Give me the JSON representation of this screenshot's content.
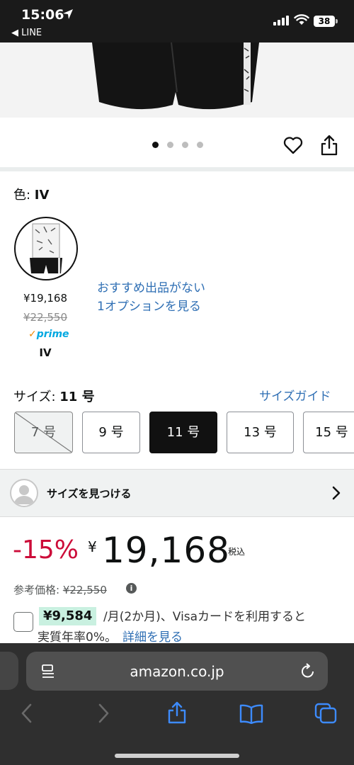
{
  "status": {
    "time": "15:06",
    "back_app": "◀ LINE",
    "battery": "38"
  },
  "carousel": {
    "count": 4,
    "active": 0
  },
  "color": {
    "label": "色: ",
    "value": "IV",
    "swatch": {
      "price": "¥19,168",
      "list_price": "¥22,550",
      "prime": "prime",
      "name": "IV"
    },
    "offer_link_line1": "おすすめ出品がない",
    "offer_link_line2": "1オプションを見る"
  },
  "size": {
    "label": "サイズ: ",
    "value": "11 号",
    "guide": "サイズガイド",
    "options": [
      {
        "label": "7 号",
        "state": "unavailable"
      },
      {
        "label": "9 号",
        "state": "available"
      },
      {
        "label": "11 号",
        "state": "selected"
      },
      {
        "label": "13 号",
        "state": "available"
      },
      {
        "label": "15 号",
        "state": "available"
      }
    ]
  },
  "find_size": {
    "label": "サイズを見つける"
  },
  "price": {
    "discount": "-15%",
    "currency": "¥",
    "amount": "19,168",
    "tax": "税込",
    "ref_label": "参考価格: ",
    "ref_value": "¥22,550"
  },
  "payment": {
    "amount": "¥9,584",
    "text": "/月(2か月)、Visaカードを利用すると",
    "text2": "実質年率0%。",
    "detail_link": "詳細を見る"
  },
  "browser": {
    "url": "amazon.co.jp"
  },
  "colors": {
    "discount": "#cc0c39",
    "link": "#2f6fb4",
    "prime": "#00a8e1",
    "highlight": "#c9f0e0"
  }
}
